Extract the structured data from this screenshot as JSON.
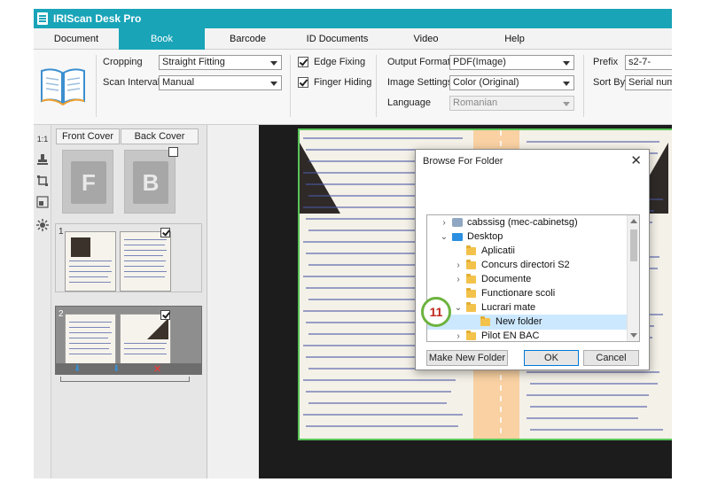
{
  "app": {
    "title": "IRIScan Desk Pro"
  },
  "tabs": [
    {
      "label": "Document",
      "active": false
    },
    {
      "label": "Book",
      "active": true
    },
    {
      "label": "Barcode",
      "active": false
    },
    {
      "label": "ID Documents",
      "active": false
    },
    {
      "label": "Video",
      "active": false
    },
    {
      "label": "Help",
      "active": false
    }
  ],
  "ribbon": {
    "cropping_label": "Cropping",
    "cropping_value": "Straight Fitting",
    "scan_interval_label": "Scan Interval",
    "scan_interval_value": "Manual",
    "edge_fixing_label": "Edge Fixing",
    "edge_fixing_checked": true,
    "finger_hiding_label": "Finger Hiding",
    "finger_hiding_checked": true,
    "output_format_label": "Output Format",
    "output_format_value": "PDF(Image)",
    "image_settings_label": "Image Settings",
    "image_settings_value": "Color (Original)",
    "language_label": "Language",
    "language_value": "Romanian",
    "prefix_label": "Prefix",
    "prefix_value": "s2-7-",
    "sort_by_label": "Sort By",
    "sort_by_value": "Serial numb"
  },
  "tools": {
    "ratio_label": "1:1"
  },
  "covers": {
    "front_label": "Front Cover",
    "back_label": "Back Cover",
    "front_letter": "F",
    "back_letter": "B"
  },
  "pages": [
    {
      "number": "1",
      "checked": true,
      "selected": false
    },
    {
      "number": "2",
      "checked": true,
      "selected": true
    }
  ],
  "dialog": {
    "title": "Browse For Folder",
    "tree": [
      {
        "label": "cabssisg (mec-cabinetsg)",
        "icon": "network-drive-icon",
        "expander": "collapsed",
        "level": 1
      },
      {
        "label": "Desktop",
        "icon": "desktop-icon",
        "expander": "expanded",
        "level": 1
      },
      {
        "label": "Aplicatii",
        "icon": "folder-icon",
        "expander": "none",
        "level": 2
      },
      {
        "label": "Concurs directori S2",
        "icon": "folder-icon",
        "expander": "collapsed",
        "level": 2
      },
      {
        "label": "Documente",
        "icon": "folder-icon",
        "expander": "collapsed",
        "level": 2
      },
      {
        "label": "Functionare scoli",
        "icon": "folder-icon",
        "expander": "none",
        "level": 2
      },
      {
        "label": "Lucrari mate",
        "icon": "folder-icon",
        "expander": "expanded",
        "level": 2
      },
      {
        "label": "New folder",
        "icon": "folder-icon",
        "expander": "none",
        "level": 3,
        "selected": true
      },
      {
        "label": "Pilot EN BAC",
        "icon": "folder-icon",
        "expander": "collapsed",
        "level": 2
      }
    ],
    "new_folder_label": "Make New Folder",
    "ok_label": "OK",
    "cancel_label": "Cancel"
  },
  "step_badge": "11",
  "colors": {
    "accent": "#19a4b8",
    "crop_border": "#58c658",
    "badge_ring": "#6db33f",
    "badge_text": "#c0261c"
  }
}
